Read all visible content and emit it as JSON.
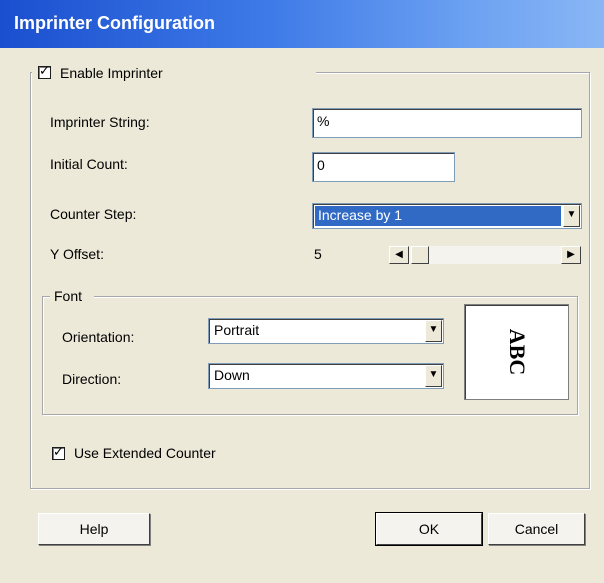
{
  "window": {
    "title": "Imprinter Configuration"
  },
  "enable_imprinter": {
    "label": "Enable Imprinter",
    "checked": true
  },
  "fields": {
    "imprinter_string": {
      "label": "Imprinter String:",
      "value": "%"
    },
    "initial_count": {
      "label": "Initial Count:",
      "value": "0"
    },
    "counter_step": {
      "label": "Counter Step:",
      "value": "Increase by 1"
    },
    "y_offset": {
      "label": "Y Offset:",
      "value": "5"
    }
  },
  "font_group": {
    "legend": "Font",
    "orientation": {
      "label": "Orientation:",
      "value": "Portrait"
    },
    "direction": {
      "label": "Direction:",
      "value": "Down"
    },
    "preview_text": "ABC"
  },
  "use_extended_counter": {
    "label": "Use Extended Counter",
    "checked": true
  },
  "buttons": {
    "help": "Help",
    "ok": "OK",
    "cancel": "Cancel"
  },
  "icons": {
    "check": "✓",
    "dropdown": "▼",
    "scroll_left": "◀",
    "scroll_right": "▶"
  }
}
